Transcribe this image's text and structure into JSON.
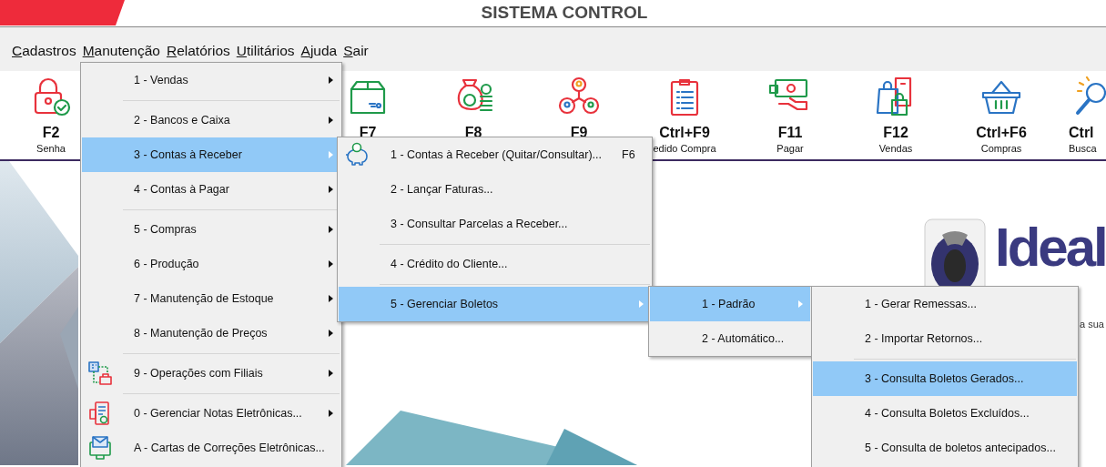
{
  "title_bar": {
    "title": "SISTEMA CONTROL"
  },
  "menu_bar": [
    {
      "label": "Cadastros"
    },
    {
      "label": "Manutenção"
    },
    {
      "label": "Relatórios"
    },
    {
      "label": "Utilitários"
    },
    {
      "label": "Ajuda"
    },
    {
      "label": "Sair"
    }
  ],
  "toolbar": [
    {
      "kind": "lock",
      "key": "F2",
      "label": "Senha"
    },
    {
      "kind": "gap"
    },
    {
      "kind": "box",
      "key": "F7"
    },
    {
      "kind": "money",
      "key": "F8"
    },
    {
      "kind": "people",
      "key": "F9"
    },
    {
      "kind": "clipboard",
      "key": "Ctrl+F9",
      "label": "edido Compra"
    },
    {
      "kind": "cash",
      "key": "F11",
      "label": "Pagar"
    },
    {
      "kind": "bags",
      "key": "F12",
      "label": "Vendas"
    },
    {
      "kind": "basket",
      "key": "Ctrl+F6",
      "label": "Compras"
    },
    {
      "kind": "search",
      "key": "Ctrl",
      "label": "Busca"
    }
  ],
  "logo": {
    "name": "Ideal",
    "tagline": "a sua"
  },
  "menus": [
    {
      "items": [
        {
          "kind": "item",
          "label": "1 - Vendas",
          "submenu": true,
          "selected": false
        },
        {
          "kind": "separator"
        },
        {
          "kind": "item",
          "label": "2 - Bancos e Caixa",
          "submenu": true,
          "selected": false
        },
        {
          "kind": "item",
          "label": "3 - Contas à Receber",
          "submenu": true,
          "selected": true
        },
        {
          "kind": "item",
          "label": "4 - Contas à Pagar",
          "submenu": true,
          "selected": false
        },
        {
          "kind": "separator"
        },
        {
          "kind": "item",
          "label": "5 - Compras",
          "submenu": true,
          "selected": false
        },
        {
          "kind": "item",
          "label": "6 - Produção",
          "submenu": true,
          "selected": false
        },
        {
          "kind": "item",
          "label": "7 - Manutenção de Estoque",
          "submenu": true,
          "selected": false
        },
        {
          "kind": "item",
          "label": "8 - Manutenção de Preços",
          "submenu": true,
          "selected": false
        },
        {
          "kind": "separator"
        },
        {
          "kind": "branches",
          "label": "9 - Operações com Filiais",
          "submenu": true,
          "selected": false
        },
        {
          "kind": "separator"
        },
        {
          "kind": "notes",
          "label": "0 - Gerenciar Notas Eletrônicas...",
          "submenu": true,
          "selected": false
        },
        {
          "kind": "mail",
          "label": "A - Cartas de Correções Eletrônicas...",
          "submenu": false,
          "selected": false
        }
      ]
    },
    {
      "items": [
        {
          "kind": "piggy",
          "label": "1 - Contas à Receber (Quitar/Consultar)...",
          "shortcut": "F6",
          "submenu": false,
          "selected": false
        },
        {
          "kind": "item",
          "label": "2 - Lançar Faturas...",
          "submenu": false,
          "selected": false
        },
        {
          "kind": "item",
          "label": "3 - Consultar Parcelas a Receber...",
          "submenu": false,
          "selected": false
        },
        {
          "kind": "separator"
        },
        {
          "kind": "item",
          "label": "4 - Crédito do Cliente...",
          "submenu": false,
          "selected": false
        },
        {
          "kind": "separator"
        },
        {
          "kind": "item",
          "label": "5 - Gerenciar Boletos",
          "submenu": true,
          "selected": true
        }
      ]
    },
    {
      "items": [
        {
          "kind": "item",
          "label": "1 - Padrão",
          "submenu": true,
          "selected": true
        },
        {
          "kind": "item",
          "label": "2 - Automático...",
          "submenu": false,
          "selected": false
        }
      ]
    },
    {
      "items": [
        {
          "kind": "item",
          "label": "1 - Gerar Remessas...",
          "submenu": false,
          "selected": false
        },
        {
          "kind": "item",
          "label": "2 - Importar Retornos...",
          "submenu": false,
          "selected": false
        },
        {
          "kind": "separator"
        },
        {
          "kind": "item",
          "label": "3 - Consulta Boletos Gerados...",
          "submenu": false,
          "selected": true
        },
        {
          "kind": "item",
          "label": "4 - Consulta Boletos Excluídos...",
          "submenu": false,
          "selected": false
        },
        {
          "kind": "item",
          "label": "5 - Consulta de boletos antecipados...",
          "submenu": false,
          "selected": false
        }
      ]
    }
  ]
}
